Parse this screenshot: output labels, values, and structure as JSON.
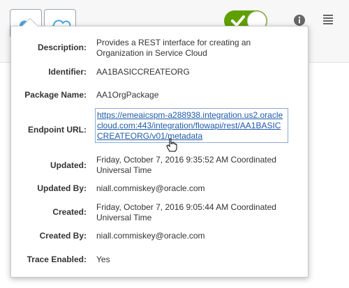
{
  "toolbar": {
    "buttons": [
      {
        "name": "cloud-solid-icon"
      },
      {
        "name": "cloud-outline-icon"
      }
    ],
    "toggle": {
      "state": "on",
      "color": "#5fa000",
      "icon": "checkmark-icon"
    },
    "info_icon": "info-icon",
    "menu_icon": "menu-icon"
  },
  "details": {
    "description": {
      "label": "Description:",
      "value": "Provides a REST interface for creating an Organization in Service Cloud"
    },
    "identifier": {
      "label": "Identifier:",
      "value": "AA1BASICCREATEORG"
    },
    "package_name": {
      "label": "Package Name:",
      "value": "AA1OrgPackage"
    },
    "endpoint_url": {
      "label": "Endpoint URL:",
      "value": "https://emeaicspm-a288938.integration.us2.oraclecloud.com:443/integration/flowapi/rest/AA1BASICCREATEORG/v01/metadata"
    },
    "updated": {
      "label": "Updated:",
      "value": "Friday, October 7, 2016 9:35:52 AM Coordinated Universal Time"
    },
    "updated_by": {
      "label": "Updated By:",
      "value": "niall.commiskey@oracle.com"
    },
    "created": {
      "label": "Created:",
      "value": "Friday, October 7, 2016 9:05:44 AM Coordinated Universal Time"
    },
    "created_by": {
      "label": "Created By:",
      "value": "niall.commiskey@oracle.com"
    },
    "trace_enabled": {
      "label": "Trace Enabled:",
      "value": "Yes"
    }
  },
  "colors": {
    "accent": "#5fa000",
    "link": "#1d5aa8",
    "cloud_blue": "#4aa3df"
  }
}
